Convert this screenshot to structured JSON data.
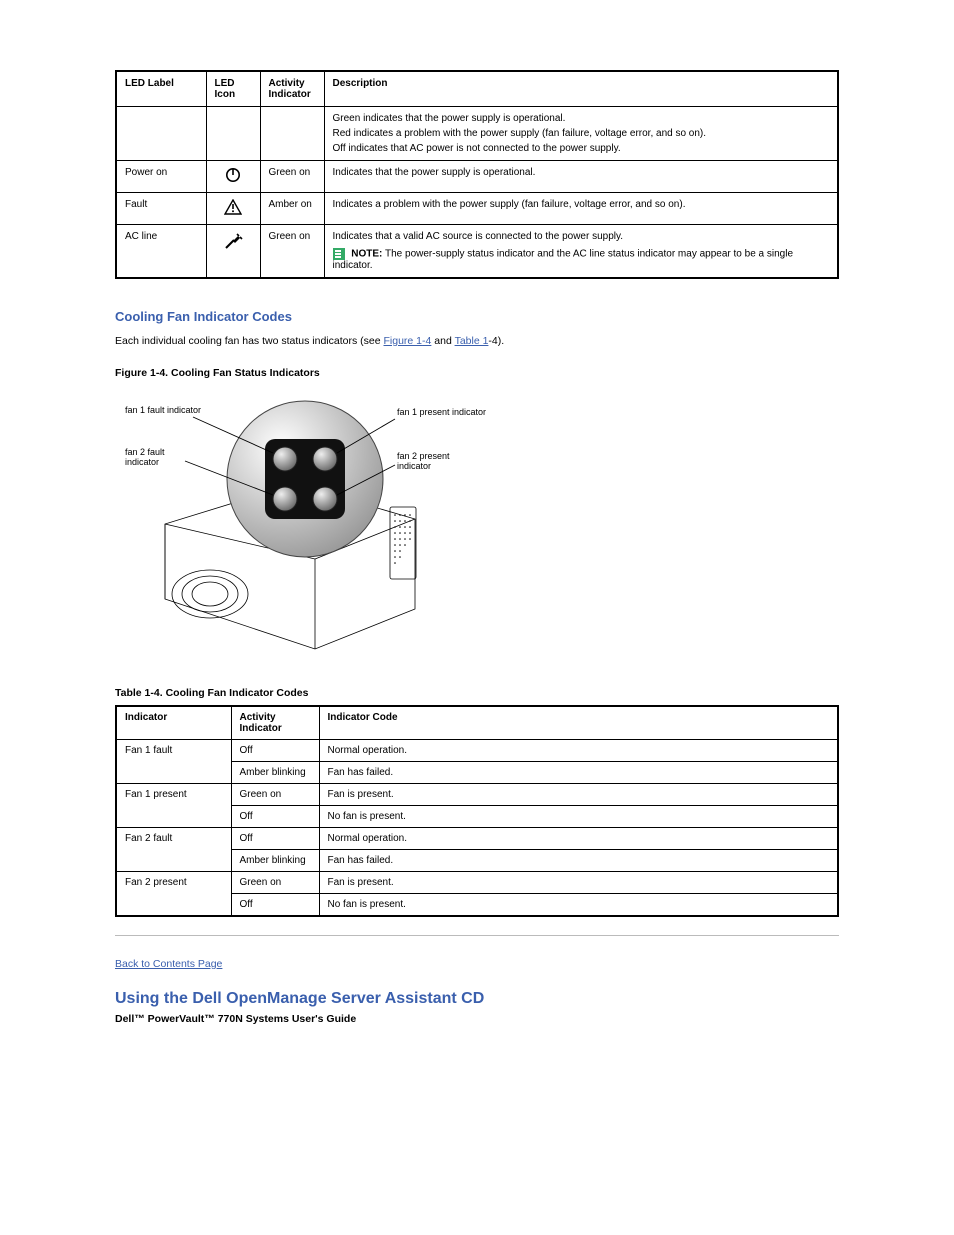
{
  "powerTable": {
    "headers": {
      "label": "LED Label",
      "icon": "LED Icon",
      "activity": "Activity Indicator",
      "desc": "Description"
    },
    "topRow": {
      "lines": [
        "Green indicates that the power supply is operational.",
        "Red indicates a problem with the power supply (fan failure, voltage error, and so on).",
        "Off indicates that AC power is not connected to the power supply."
      ]
    },
    "rows": [
      {
        "label": "Power on",
        "icon": "power",
        "activity": "Green on",
        "desc": "Indicates that the power supply is operational."
      },
      {
        "label": "Fault",
        "icon": "caution",
        "activity": "Amber on",
        "desc": "Indicates a problem with the power supply (fan failure, voltage error, and so on)."
      },
      {
        "label": "AC line",
        "icon": "bolt",
        "activity": "Green on",
        "desc_line1": "Indicates that a valid AC source is connected to the power supply.",
        "note_label": "NOTE:",
        "note": "The power-supply status indicator and the AC line status indicator may appear to be a single indicator."
      }
    ]
  },
  "section": {
    "heading": "Cooling Fan Indicator Codes",
    "para_a": "Each individual cooling fan has two status indicators (see",
    "link_fig": "Figure 1",
    "link_tbl": "Table 1",
    "para_b": "and",
    "para_c": "-4).",
    "fig_label": "Figure 1-4. Cooling Fan Status Indicators",
    "tbl_label": "Table 1-4. Cooling Fan Indicator Codes"
  },
  "figure": {
    "callout1": "fan 1 fault indicator",
    "callout2": "fan 2 fault indicator",
    "callout3": "fan 1 present indicator",
    "callout4": "fan 2 present indicator"
  },
  "fanTable": {
    "headers": {
      "ind": "Indicator",
      "act": "Activity Indicator",
      "code": "Indicator Code"
    },
    "rows": [
      {
        "ind": "Fan 1 fault",
        "a1": "Off",
        "c1": "Normal operation.",
        "a2": "Amber blinking",
        "c2": "Fan has failed."
      },
      {
        "ind": "Fan 1 present",
        "a1": "Green on",
        "c1": "Fan is present.",
        "a2": "Off",
        "c2": "No fan is present."
      },
      {
        "ind": "Fan 2 fault",
        "a1": "Off",
        "c1": "Normal operation.",
        "a2": "Amber blinking",
        "c2": "Fan has failed."
      },
      {
        "ind": "Fan 2 present",
        "a1": "Green on",
        "c1": "Fan is present.",
        "a2": "Off",
        "c2": "No fan is present."
      }
    ]
  },
  "back": {
    "subhead": "Back to Contents Page",
    "title": "Using the Dell OpenManage Server Assistant CD",
    "subtitle": "Dell™ PowerVault™ 770N Systems User's Guide"
  }
}
